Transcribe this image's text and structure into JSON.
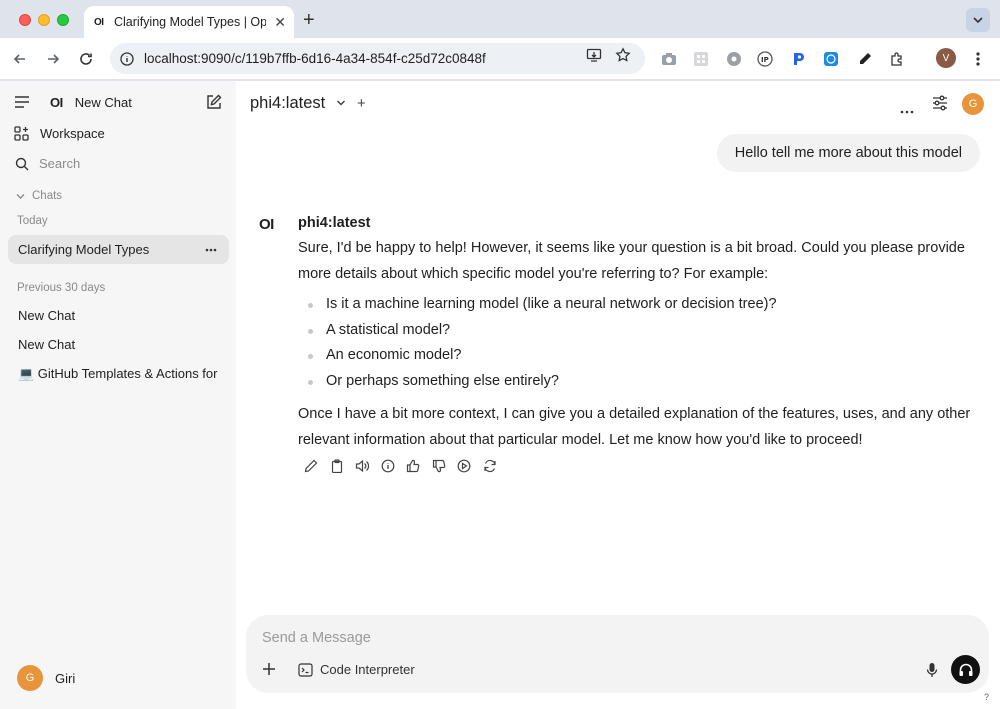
{
  "browser": {
    "tab_favicon": "OI",
    "tab_title": "Clarifying Model Types | Open WebUI",
    "url": "localhost:9090/c/119b7ffb-6d16-4a34-854f-c25d72c0848f",
    "profile_initial": "V"
  },
  "sidebar": {
    "logo": "OI",
    "new_chat_label": "New Chat",
    "workspace_label": "Workspace",
    "search_placeholder": "Search",
    "chats_heading": "Chats",
    "today_heading": "Today",
    "active_chat": "Clarifying Model Types",
    "previous_heading": "Previous 30 days",
    "previous_chats": [
      "New Chat",
      "New Chat",
      "💻 GitHub Templates & Actions for"
    ],
    "user": {
      "initial": "G",
      "name": "Giri"
    }
  },
  "header": {
    "model_name": "phi4:latest",
    "avatar_initial": "G"
  },
  "conversation": {
    "user_message": "Hello tell me more about this model",
    "assistant": {
      "logo": "OI",
      "name": "phi4:latest",
      "paragraph1": "Sure, I'd be happy to help! However, it seems like your question is a bit broad. Could you please provide more details about which specific model you're referring to? For example:",
      "bullets": [
        "Is it a machine learning model (like a neural network or decision tree)?",
        "A statistical model?",
        "An economic model?",
        "Or perhaps something else entirely?"
      ],
      "paragraph2": "Once I have a bit more context, I can give you a detailed explanation of the features, uses, and any other relevant information about that particular model. Let me know how you'd like to proceed!"
    }
  },
  "composer": {
    "placeholder": "Send a Message",
    "code_interpreter_label": "Code Interpreter",
    "help": "?"
  },
  "colors": {
    "accent_avatar": "#e8943a",
    "sidebar_bg": "#f6f6f6",
    "active_chat_bg": "#e5e5e5"
  }
}
